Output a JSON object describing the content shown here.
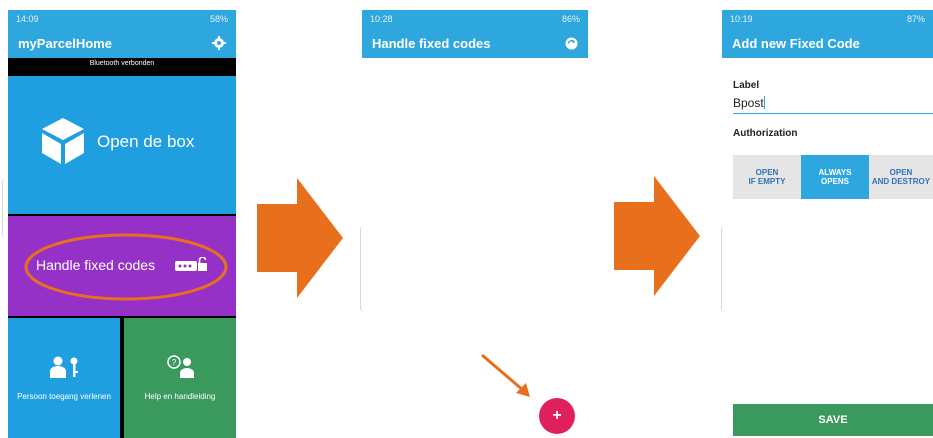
{
  "screen1": {
    "status": {
      "time": "14:09",
      "right": "58%"
    },
    "appbar": {
      "title": "myParcelHome"
    },
    "bluetooth_banner": "Bluetooth verbonden",
    "tiles": {
      "open_box": "Open de box",
      "fixed_codes": "Handle fixed codes",
      "person": "Persoon toegang verlenen",
      "help": "Help en handleiding"
    }
  },
  "screen2": {
    "status": {
      "time": "10:28",
      "right": "86%"
    },
    "appbar": {
      "title": "Handle fixed codes"
    },
    "fab_label": "+"
  },
  "screen3": {
    "status": {
      "time": "10:19",
      "right": "87%"
    },
    "appbar": {
      "title": "Add new Fixed Code"
    },
    "form": {
      "label_heading": "Label",
      "label_value": "Bpost",
      "auth_heading": "Authorization",
      "options": [
        {
          "line1": "OPEN",
          "line2": "IF EMPTY",
          "selected": false
        },
        {
          "line1": "ALWAYS",
          "line2": "OPENS",
          "selected": true
        },
        {
          "line1": "OPEN",
          "line2": "AND DESTROY",
          "selected": false
        }
      ]
    },
    "save_label": "SAVE"
  },
  "colors": {
    "accent_blue": "#2ea7df",
    "purple": "#9631c7",
    "green": "#3a9a5e",
    "orange": "#e8701d",
    "fab_pink": "#e0205d"
  }
}
